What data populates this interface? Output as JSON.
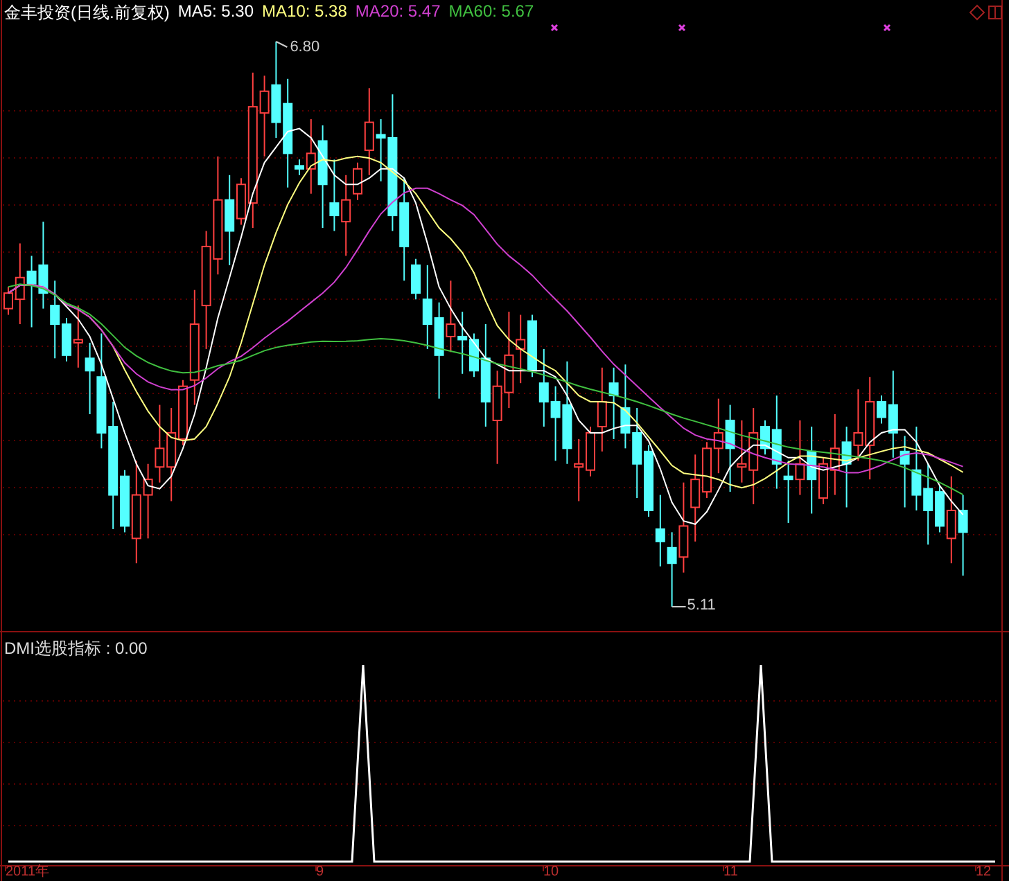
{
  "legend": {
    "name": "金丰投资(日线.前复权)",
    "items": [
      {
        "label": "MA5: 5.30",
        "color": "#ffffff"
      },
      {
        "label": "MA10: 5.38",
        "color": "#ffff80"
      },
      {
        "label": "MA20: 5.47",
        "color": "#d040d0"
      },
      {
        "label": "MA60: 5.67",
        "color": "#40c040"
      }
    ]
  },
  "price_labels": [
    {
      "text": "6.80"
    },
    {
      "text": "5.11"
    }
  ],
  "indicator": {
    "label": "DMI选股指标 : 0.00"
  },
  "axis": {
    "labels": [
      "2011年",
      "9",
      "10",
      "11",
      "12"
    ]
  }
}
